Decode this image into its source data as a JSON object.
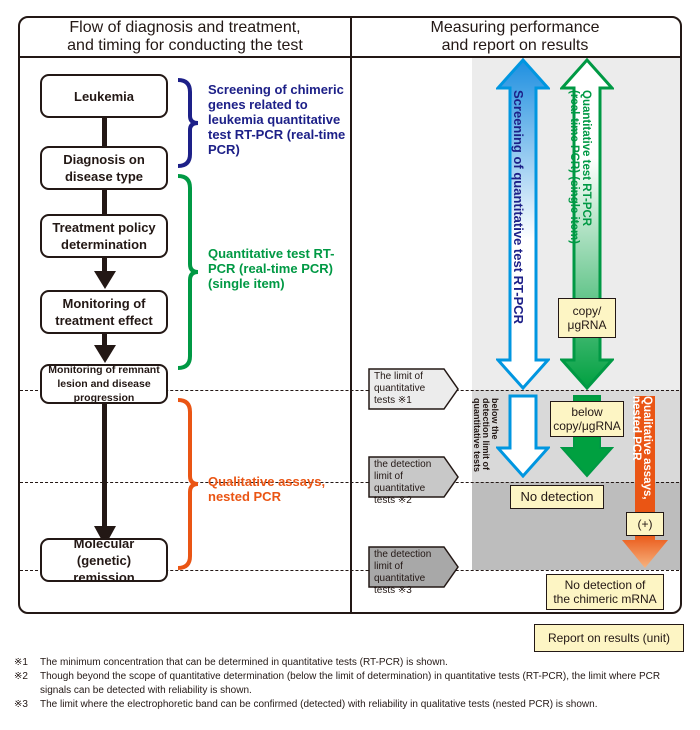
{
  "headers": {
    "left": "Flow of diagnosis and treatment,\nand timing for conducting the test",
    "right": "Measuring performance\nand report on results"
  },
  "flow_steps": [
    {
      "label": "Leukemia"
    },
    {
      "label": "Diagnosis on disease type"
    },
    {
      "label": "Treatment policy determination"
    },
    {
      "label": "Monitoring of treatment effect"
    },
    {
      "label": "Monitoring of remnant lesion and disease progression"
    },
    {
      "label": "Molecular (genetic) remission"
    }
  ],
  "brackets": [
    {
      "label": "Screening of chimeric genes related to leukemia quantitative test RT-PCR (real-time PCR)",
      "color": "#1d2088"
    },
    {
      "label": "Quantitative test RT-PCR (real-time PCR) (single item)",
      "color": "#009944"
    },
    {
      "label": "Qualitative assays, nested PCR",
      "color": "#ea5514"
    }
  ],
  "limits": [
    {
      "label": "The limit of\nquantitative\ntests ※1"
    },
    {
      "label": "the detection\nlimit of quantitative\ntests ※2"
    },
    {
      "label": "the detection\nlimit of quantitative\ntests ※3"
    }
  ],
  "arrows": {
    "screening": "Screening of quantitative test RT-PCR",
    "quantitative": "Quantitative test RT-PCR\n(real-time PCR) (single item)",
    "below_detection": "below the\ndetection limit of\nquantitative tests",
    "qualitative": "Qualitative assays,\nnested PCR"
  },
  "result_boxes": {
    "copy": "copy/\nμgRNA",
    "below_copy": "below\ncopy/μgRNA",
    "no_detection": "No detection",
    "plus": "(+)",
    "no_detection_chimeric": "No detection of\nthe chimeric mRNA",
    "report_legend": "Report on results (unit)"
  },
  "colors": {
    "blue": "#0096e0",
    "green": "#009944",
    "orange": "#ea5514",
    "navy": "#1d2088"
  },
  "notes": [
    {
      "mark": "※1",
      "text": "The minimum concentration that can be determined in quantitative tests (RT-PCR) is shown."
    },
    {
      "mark": "※2",
      "text": "Though beyond the scope of quantitative determination (below the limit of determination) in quantitative tests (RT-PCR), the limit where PCR signals can be detected with reliability is shown."
    },
    {
      "mark": "※3",
      "text": "The limit where the electrophoretic band can be confirmed (detected) with reliability in qualitative tests (nested PCR) is shown."
    }
  ]
}
